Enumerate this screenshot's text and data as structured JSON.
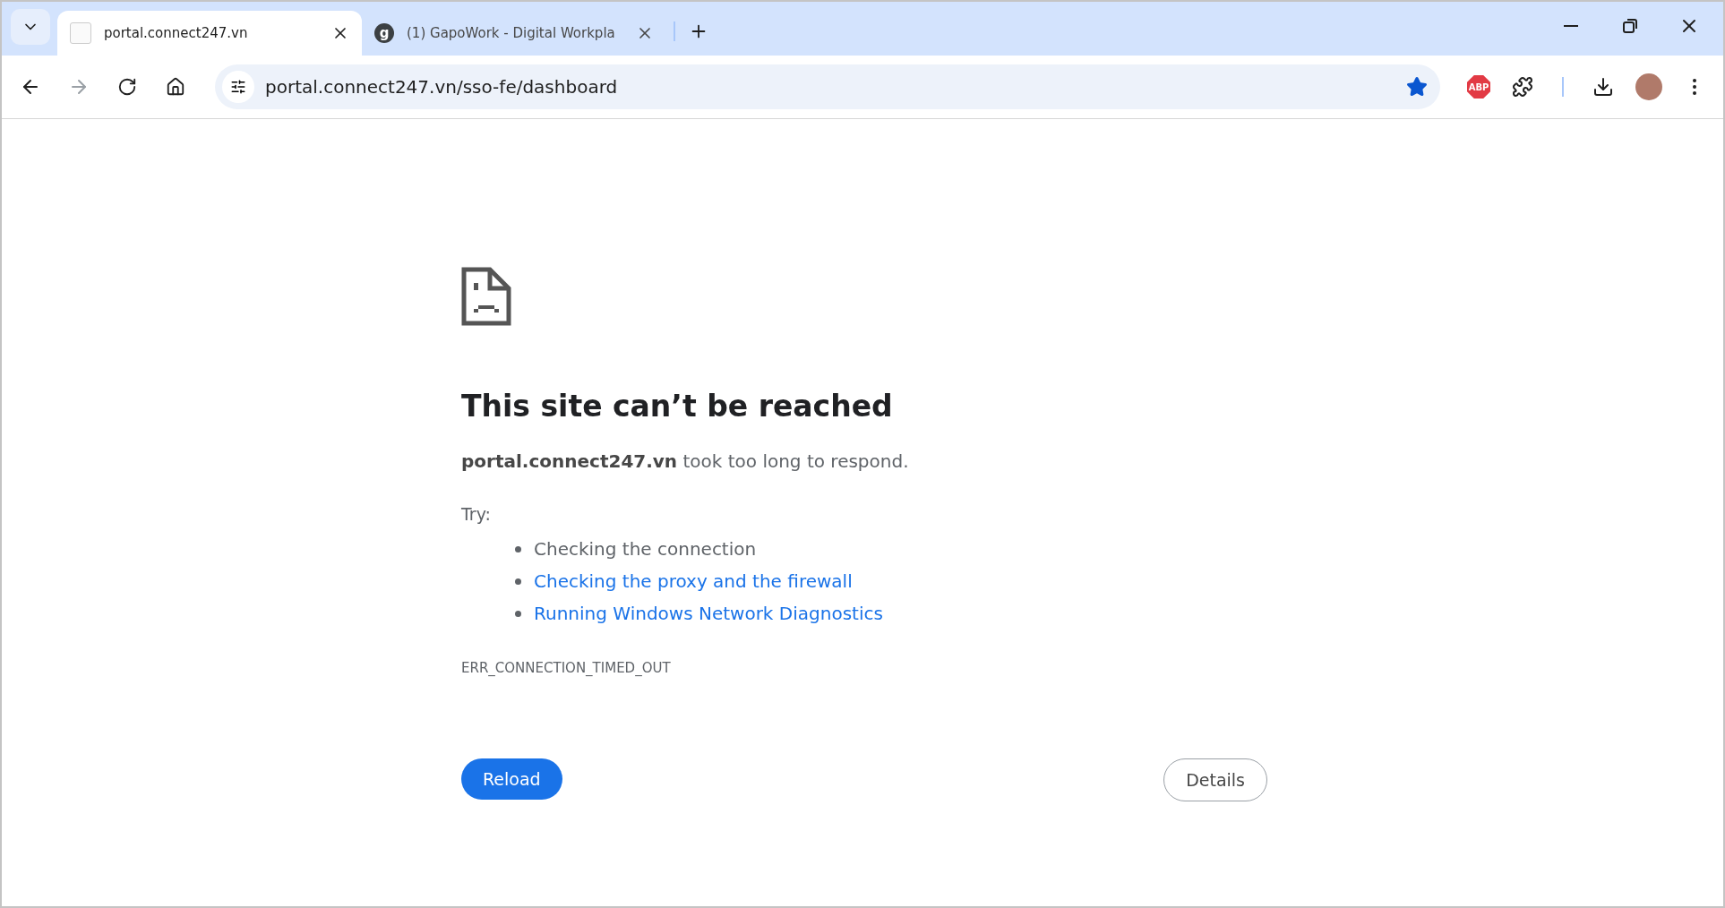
{
  "tabs": [
    {
      "title": "portal.connect247.vn",
      "selected": true
    },
    {
      "title": "(1) GapoWork - Digital Workpla",
      "selected": false,
      "favicon_letter": "g"
    }
  ],
  "address_bar": {
    "url": "portal.connect247.vn/sso-fe/dashboard",
    "bookmarked": true
  },
  "extensions": {
    "adblock_label": "ABP"
  },
  "error": {
    "title": "This site can’t be reached",
    "message": "**portal.connect247.vn** took too long to respond.",
    "try_label": "Try:",
    "suggestions": [
      {
        "text": "Checking the connection",
        "kind": "text"
      },
      {
        "text": "Checking the proxy and the firewall",
        "kind": "link"
      },
      {
        "text": "Running Windows Network Diagnostics",
        "kind": "link"
      }
    ],
    "code": "ERR_CONNECTION_TIMED_OUT"
  },
  "buttons": {
    "reload": "Reload",
    "details": "Details"
  }
}
